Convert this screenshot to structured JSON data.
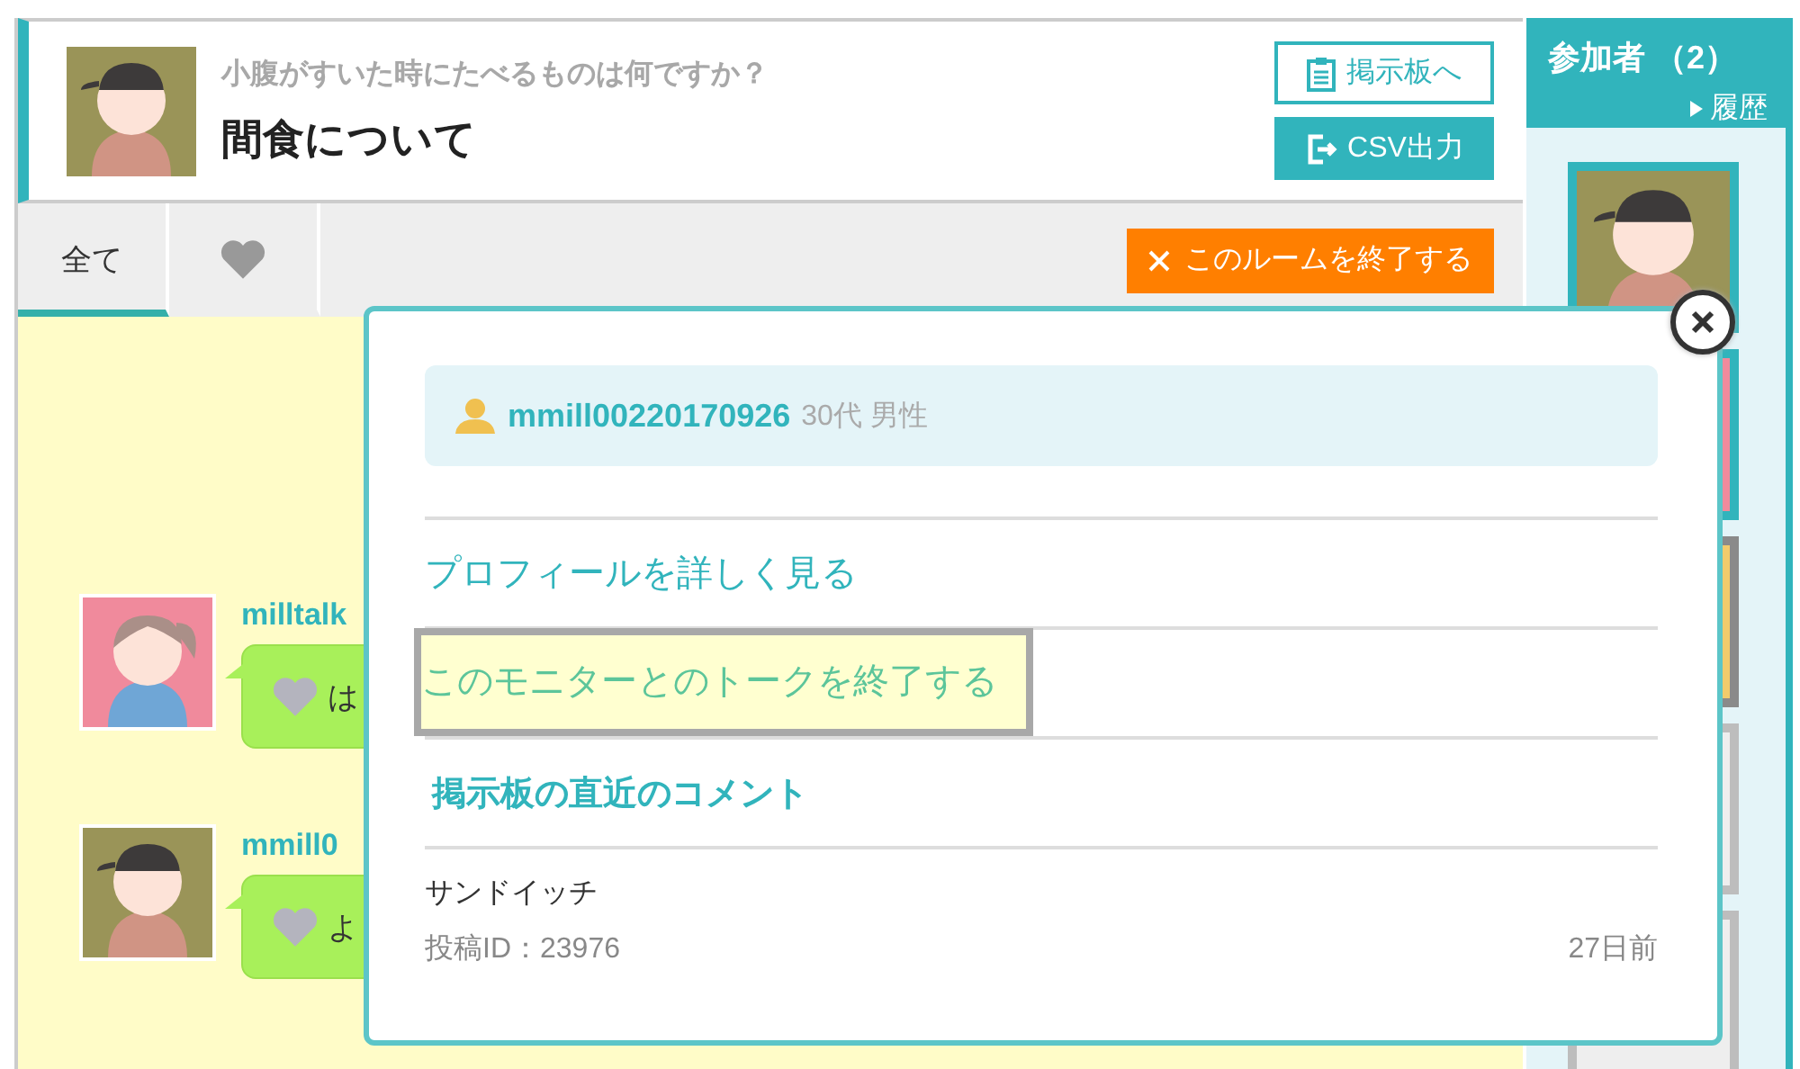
{
  "header": {
    "question": "小腹がすいた時にたべるものは何ですか？",
    "title": "間食について",
    "buttons": [
      {
        "kind": "board",
        "label": "掲示板へ"
      },
      {
        "kind": "csv",
        "label": "CSV出力"
      }
    ]
  },
  "tabs": [
    {
      "kind": "text",
      "label": "全て",
      "selected": true
    },
    {
      "kind": "heart",
      "selected": false
    }
  ],
  "end_room_button": "このルームを終了する",
  "messages": [
    {
      "kind": "woman",
      "name": "milltalk",
      "text": "は"
    },
    {
      "kind": "man",
      "name": "mmill0",
      "text": "よ"
    }
  ],
  "sidebar": {
    "title": "参加者 （2）",
    "history_link": "履歴",
    "participants": [
      {
        "kind": "man",
        "color": "#31b4bc"
      },
      {
        "kind": "woman",
        "color": "#31b4bc"
      },
      {
        "kind": "yellow",
        "color": "#8a8a8a"
      },
      {
        "kind": "empty",
        "color": "#bdbdbd"
      },
      {
        "kind": "empty",
        "color": "#bdbdbd"
      }
    ]
  },
  "modal": {
    "user": {
      "name": "mmill00220170926",
      "meta": "30代 男性"
    },
    "links": [
      {
        "label": "プロフィールを詳しく見る",
        "highlighted": false
      },
      {
        "label": "このモニターとのトークを終了する",
        "highlighted": true
      }
    ],
    "section_title": "掲示板の直近のコメント",
    "comment": {
      "text": "サンドイッチ",
      "post_id": "投稿ID：23976",
      "age": "27日前"
    }
  }
}
